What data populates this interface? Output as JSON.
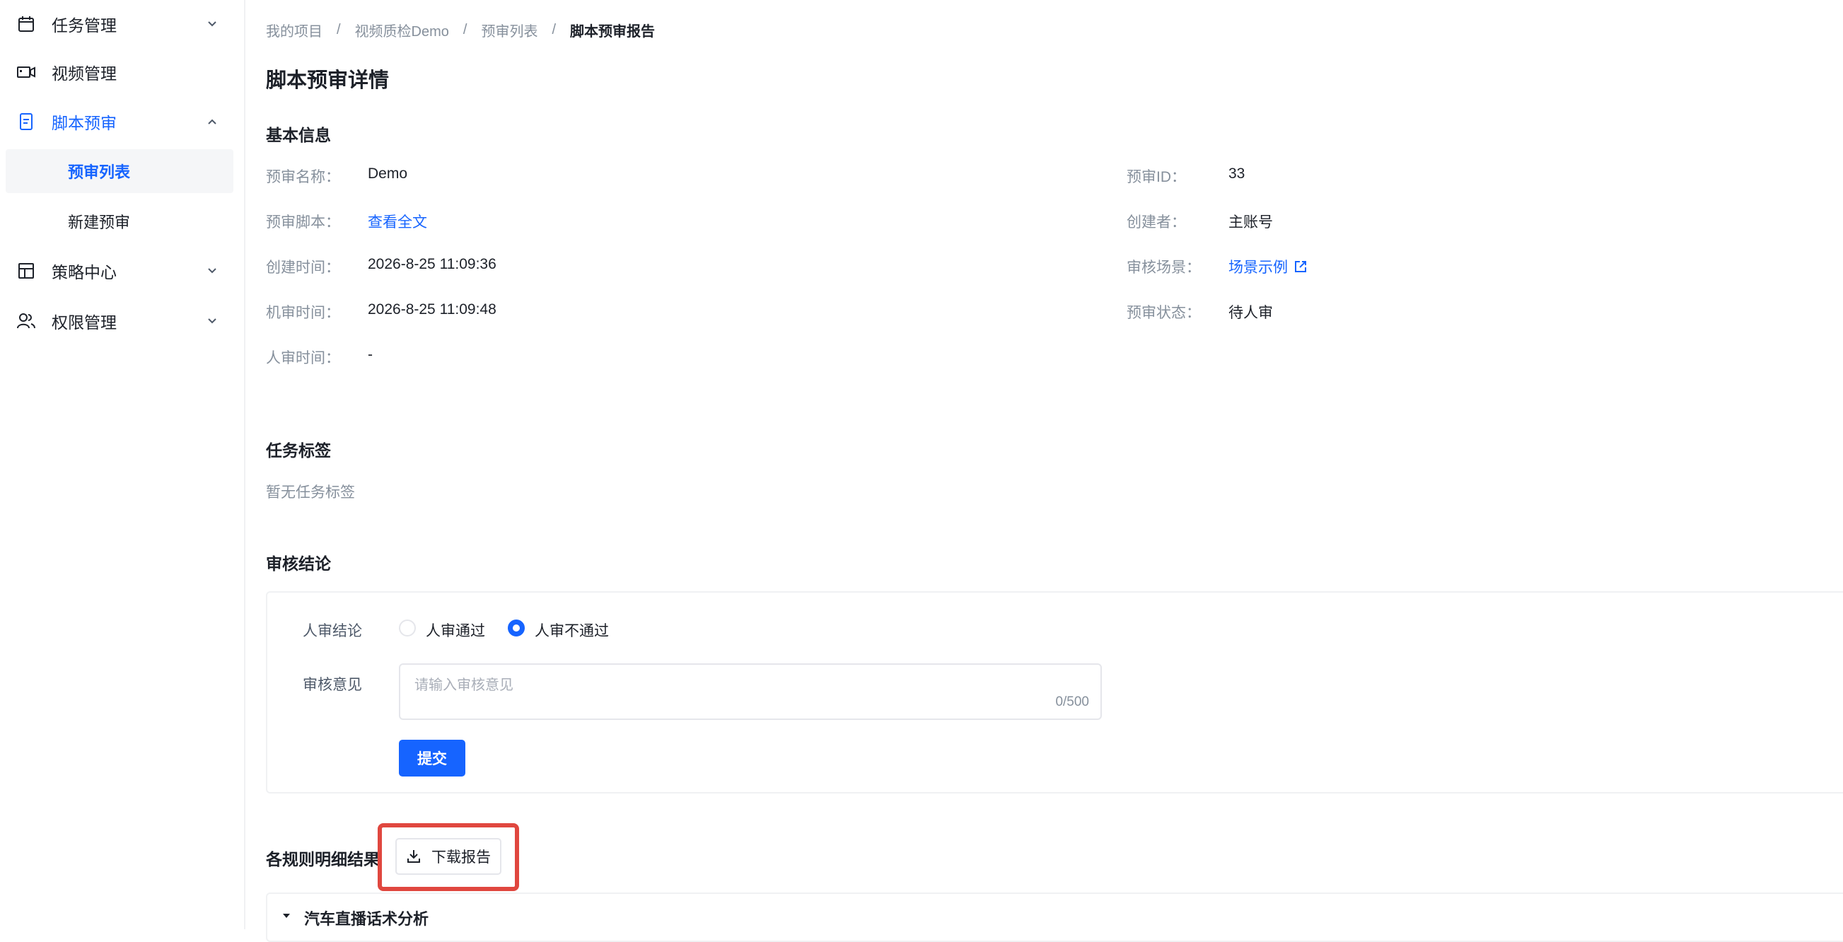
{
  "sidebar": {
    "items": [
      {
        "label": "任务管理",
        "icon": "calendar-icon"
      },
      {
        "label": "视频管理",
        "icon": "video-camera-icon"
      },
      {
        "label": "脚本预审",
        "icon": "document-icon"
      },
      {
        "label": "策略中心",
        "icon": "layout-icon"
      },
      {
        "label": "权限管理",
        "icon": "users-icon"
      }
    ],
    "subitems": [
      {
        "label": "预审列表"
      },
      {
        "label": "新建预审"
      }
    ]
  },
  "breadcrumb": [
    "我的项目",
    "视频质检Demo",
    "预审列表",
    "脚本预审报告"
  ],
  "breadcrumb_sep": "/",
  "page_title": "脚本预审详情",
  "basic_info": {
    "title": "基本信息",
    "left": [
      {
        "label": "预审名称：",
        "value": "Demo"
      },
      {
        "label": "预审脚本：",
        "value": "查看全文"
      },
      {
        "label": "创建时间：",
        "value": "2026-8-25 11:09:36"
      },
      {
        "label": "机审时间：",
        "value": "2026-8-25 11:09:48"
      },
      {
        "label": "人审时间：",
        "value": "-"
      }
    ],
    "right": [
      {
        "label": "预审ID：",
        "value": "33"
      },
      {
        "label": "创建者：",
        "value": "主账号"
      },
      {
        "label": "审核场景：",
        "value": "场景示例"
      },
      {
        "label": "预审状态：",
        "value": "待人审"
      }
    ]
  },
  "tags": {
    "title": "任务标签",
    "empty": "暂无任务标签"
  },
  "review": {
    "title": "审核结论",
    "conclusion_label": "人审结论",
    "options": [
      "人审通过",
      "人审不通过"
    ],
    "selected": "人审不通过",
    "opinion_label": "审核意见",
    "opinion_placeholder": "请输入审核意见",
    "opinion_count": "0/500",
    "submit": "提交"
  },
  "rules": {
    "title": "各规则明细结果",
    "download": "下载报告",
    "panel_title": "汽车直播话术分析"
  },
  "colors": {
    "primary": "#1664ff",
    "highlight": "#e0473f"
  }
}
